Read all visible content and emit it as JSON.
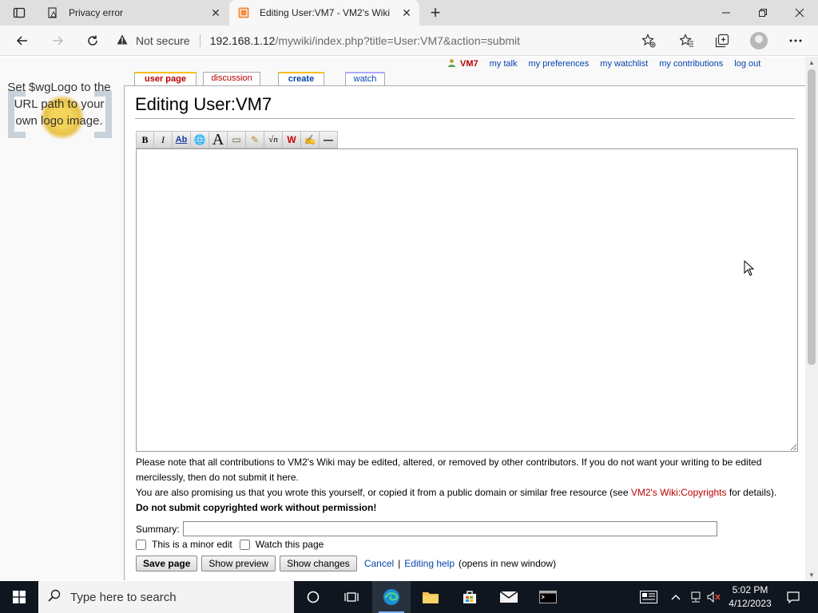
{
  "browser": {
    "tabs": [
      {
        "title": "Privacy error",
        "close": "✕"
      },
      {
        "title": "Editing User:VM7 - VM2's Wiki",
        "close": "✕"
      }
    ],
    "new_tab": "+",
    "address": {
      "security": "Not secure",
      "host": "192.168.1.12",
      "path": "/mywiki/index.php?title=User:VM7&action=submit"
    }
  },
  "wiki": {
    "logo_text": "Set $wgLogo to the URL path to your own logo image.",
    "personal": {
      "user": "VM7",
      "links": [
        "my talk",
        "my preferences",
        "my watchlist",
        "my contributions",
        "log out"
      ]
    },
    "content_tabs": [
      "user page",
      "discussion",
      "create",
      "watch"
    ],
    "title": "Editing User:VM7",
    "toolbar": [
      "B",
      "I",
      "Ab",
      "🌐",
      "A",
      "▭",
      "✎",
      "√n",
      "W",
      "✍",
      "—"
    ],
    "textarea_value": "",
    "notice": {
      "p1": "Please note that all contributions to VM2's Wiki may be edited, altered, or removed by other contributors. If you do not want your writing to be edited mercilessly, then do not submit it here.",
      "p2_start": "You are also promising us that you wrote this yourself, or copied it from a public domain or similar free resource (see ",
      "p2_link": "VM2's Wiki:Copyrights",
      "p2_end": " for details). ",
      "p2_bold": "Do not submit copyrighted work without permission!"
    },
    "summary_label": "Summary:",
    "summary_value": "",
    "minor_edit": "This is a minor edit",
    "watch_page": "Watch this page",
    "buttons": {
      "save": "Save page",
      "preview": "Show preview",
      "changes": "Show changes"
    },
    "cancel": "Cancel",
    "pipe": "|",
    "editing_help": "Editing help",
    "new_window": "(opens in new window)"
  },
  "taskbar": {
    "search_placeholder": "Type here to search",
    "time": "5:02 PM",
    "date": "4/12/2023"
  },
  "colors": {
    "link": "#0645ad",
    "new_link": "#ba0000",
    "tab_accent": "#fabd23"
  }
}
